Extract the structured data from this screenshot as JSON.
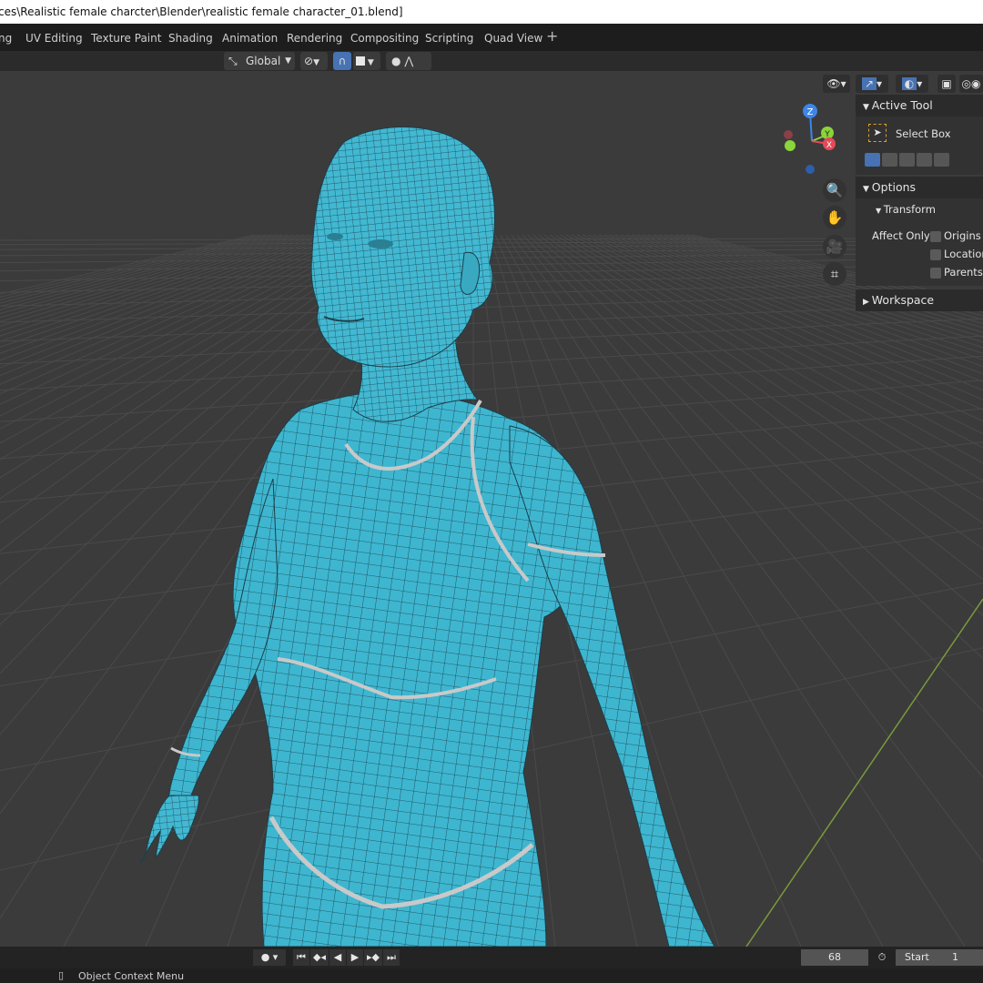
{
  "window": {
    "title": "ces\\Realistic female charcter\\Blender\\realistic female character_01.blend]"
  },
  "workspace_tabs": [
    {
      "label": "ng"
    },
    {
      "label": "UV Editing"
    },
    {
      "label": "Texture Paint"
    },
    {
      "label": "Shading"
    },
    {
      "label": "Animation"
    },
    {
      "label": "Rendering"
    },
    {
      "label": "Compositing"
    },
    {
      "label": "Scripting"
    },
    {
      "label": "Quad View"
    },
    {
      "label": "+"
    }
  ],
  "toolbar": {
    "transform_orientation": "Global",
    "orientation_icon": "axis-icon",
    "pivot_icon": "pivot-icon",
    "snap_icon": "magnet-icon",
    "proportional_icon": "proportional-edit-icon"
  },
  "viewport_header": {
    "icons": [
      "eye-icon",
      "gizmo-icon",
      "overlay-icon",
      "xray-icon",
      "wireframe-shading-icon"
    ]
  },
  "gizmo": {
    "z_label": "Z",
    "y_label": "Y",
    "x_label": "X",
    "colors": {
      "x": "#e24a5a",
      "y": "#8bd43a",
      "z": "#3b86e8"
    }
  },
  "nav_buttons": [
    "zoom-icon",
    "pan-hand-icon",
    "camera-icon",
    "grid-perspective-icon"
  ],
  "n_panel": {
    "active_tool_header": "Active Tool",
    "tool_name": "Select Box",
    "options_header": "Options",
    "transform_header": "Transform",
    "affect_only_label": "Affect Only",
    "checkboxes": [
      {
        "label": "Origins",
        "checked": false
      },
      {
        "label": "Location",
        "checked": false
      },
      {
        "label": "Parents",
        "checked": false
      }
    ],
    "workspace_header": "Workspace"
  },
  "timeline": {
    "current_frame": "68",
    "start_label": "Start",
    "start_value": "1",
    "playback_buttons": [
      "jump-start-icon",
      "prev-keyframe-icon",
      "play-reverse-icon",
      "play-icon",
      "next-keyframe-icon",
      "jump-end-icon"
    ]
  },
  "statusbar": {
    "mouse_hint": "Object Context Menu"
  },
  "colors": {
    "mesh": "#3eb6d0",
    "grid_bg": "#3b3b3b",
    "y_axis_line": "#7a9a3a"
  }
}
